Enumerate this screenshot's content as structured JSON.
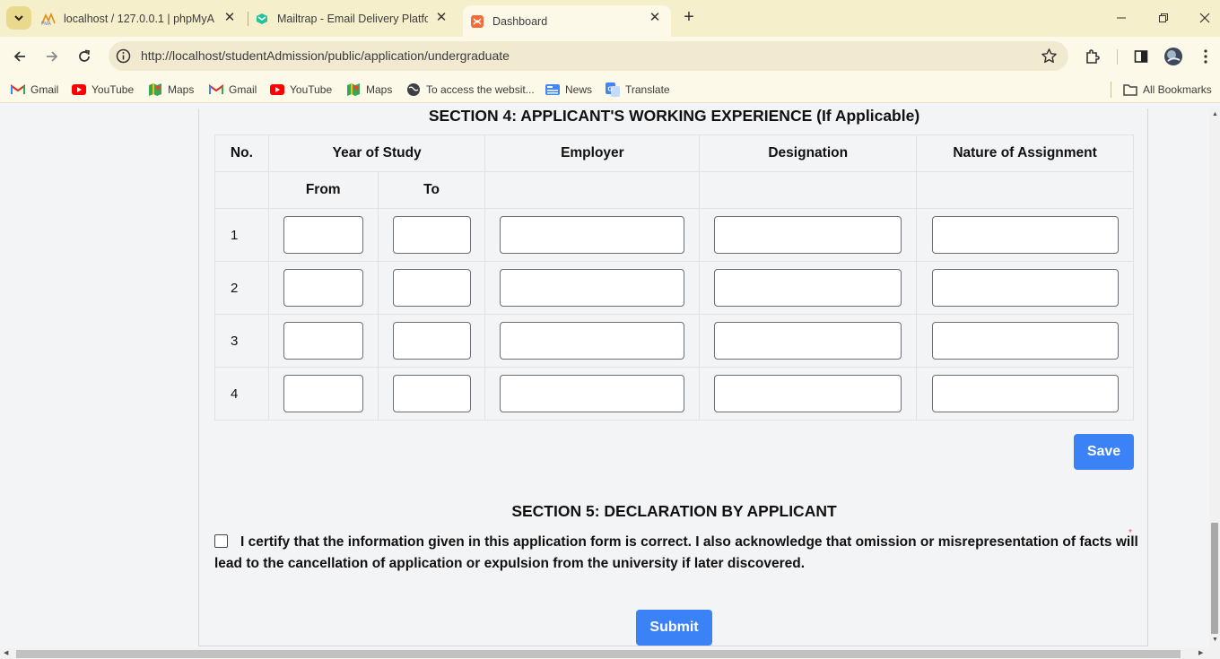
{
  "browser": {
    "tabs": [
      {
        "title": "localhost / 127.0.0.1 | phpMyAd",
        "icon": "phpmyadmin-icon"
      },
      {
        "title": "Mailtrap - Email Delivery Platfor",
        "icon": "mailtrap-icon"
      },
      {
        "title": "Dashboard",
        "icon": "dashboard-icon",
        "active": true
      }
    ],
    "url": "http://localhost/studentAdmission/public/application/undergraduate",
    "bookmarks": [
      {
        "label": "Gmail",
        "icon": "gmail-icon"
      },
      {
        "label": "YouTube",
        "icon": "youtube-icon"
      },
      {
        "label": "Maps",
        "icon": "maps-icon"
      },
      {
        "label": "Gmail",
        "icon": "gmail-icon"
      },
      {
        "label": "YouTube",
        "icon": "youtube-icon"
      },
      {
        "label": "Maps",
        "icon": "maps-icon"
      },
      {
        "label": "To access the websit...",
        "icon": "globe-icon"
      },
      {
        "label": "News",
        "icon": "news-icon"
      },
      {
        "label": "Translate",
        "icon": "translate-icon"
      }
    ],
    "all_bookmarks": "All Bookmarks",
    "colors": {
      "tabstrip": "#f6efcc",
      "toolbar": "#fdf9e8",
      "accent": "#3b82f6"
    }
  },
  "section4": {
    "title": "SECTION 4: APPLICANT'S WORKING EXPERIENCE (If Applicable)",
    "headers": {
      "no": "No.",
      "year_of_study": "Year of Study",
      "employer": "Employer",
      "designation": "Designation",
      "nature": "Nature of Assignment",
      "from": "From",
      "to": "To"
    },
    "rows": [
      {
        "no": "1",
        "from": "",
        "to": "",
        "employer": "",
        "designation": "",
        "nature": ""
      },
      {
        "no": "2",
        "from": "",
        "to": "",
        "employer": "",
        "designation": "",
        "nature": ""
      },
      {
        "no": "3",
        "from": "",
        "to": "",
        "employer": "",
        "designation": "",
        "nature": ""
      },
      {
        "no": "4",
        "from": "",
        "to": "",
        "employer": "",
        "designation": "",
        "nature": ""
      }
    ],
    "save_label": "Save"
  },
  "section5": {
    "title": "SECTION 5: DECLARATION BY APPLICANT",
    "declaration": "I certify that the information given in this application form is correct. I also acknowledge that omission or misrepresentation of facts will lead to the cancellation of application or expulsion from the university if later discovered.",
    "checked": false,
    "required_mark": "*",
    "submit_label": "Submit"
  }
}
